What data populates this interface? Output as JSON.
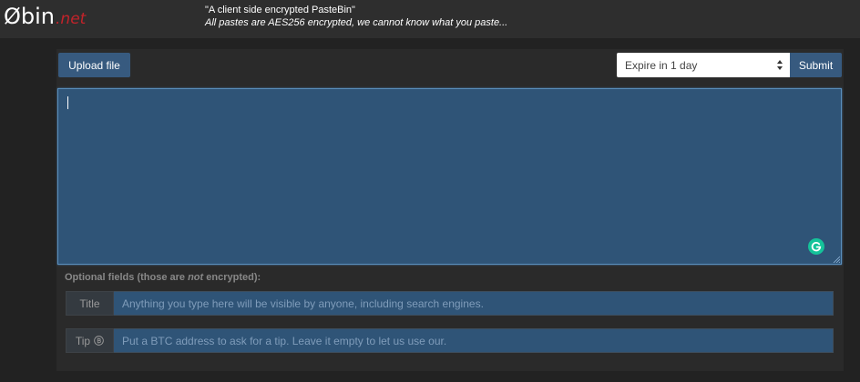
{
  "header": {
    "logo_main": "Øbin",
    "logo_suffix": ".net",
    "tagline": "\"A client side encrypted PasteBin\"",
    "subline": "All pastes are AES256 encrypted, we cannot know what you paste..."
  },
  "toolbar": {
    "upload_label": "Upload file",
    "expire_selected": "Expire in 1 day",
    "submit_label": "Submit"
  },
  "paste": {
    "value": ""
  },
  "optional": {
    "label_before": "Optional fields (those are ",
    "label_em": "not",
    "label_after": " encrypted):",
    "title_addon": "Title",
    "title_placeholder": "Anything you type here will be visible by anyone, including search engines.",
    "tip_addon": "Tip",
    "tip_placeholder": "Put a BTC address to ask for a tip. Leave it empty to let us use our."
  },
  "colors": {
    "brand_red": "#c3232a",
    "primary": "#375a7f",
    "textarea_bg": "#2f5477",
    "grammarly": "#15c39a"
  },
  "icons": {
    "grammarly": "grammarly-icon",
    "bitcoin": "bitcoin-icon",
    "select_arrows": "select-arrows-icon"
  }
}
